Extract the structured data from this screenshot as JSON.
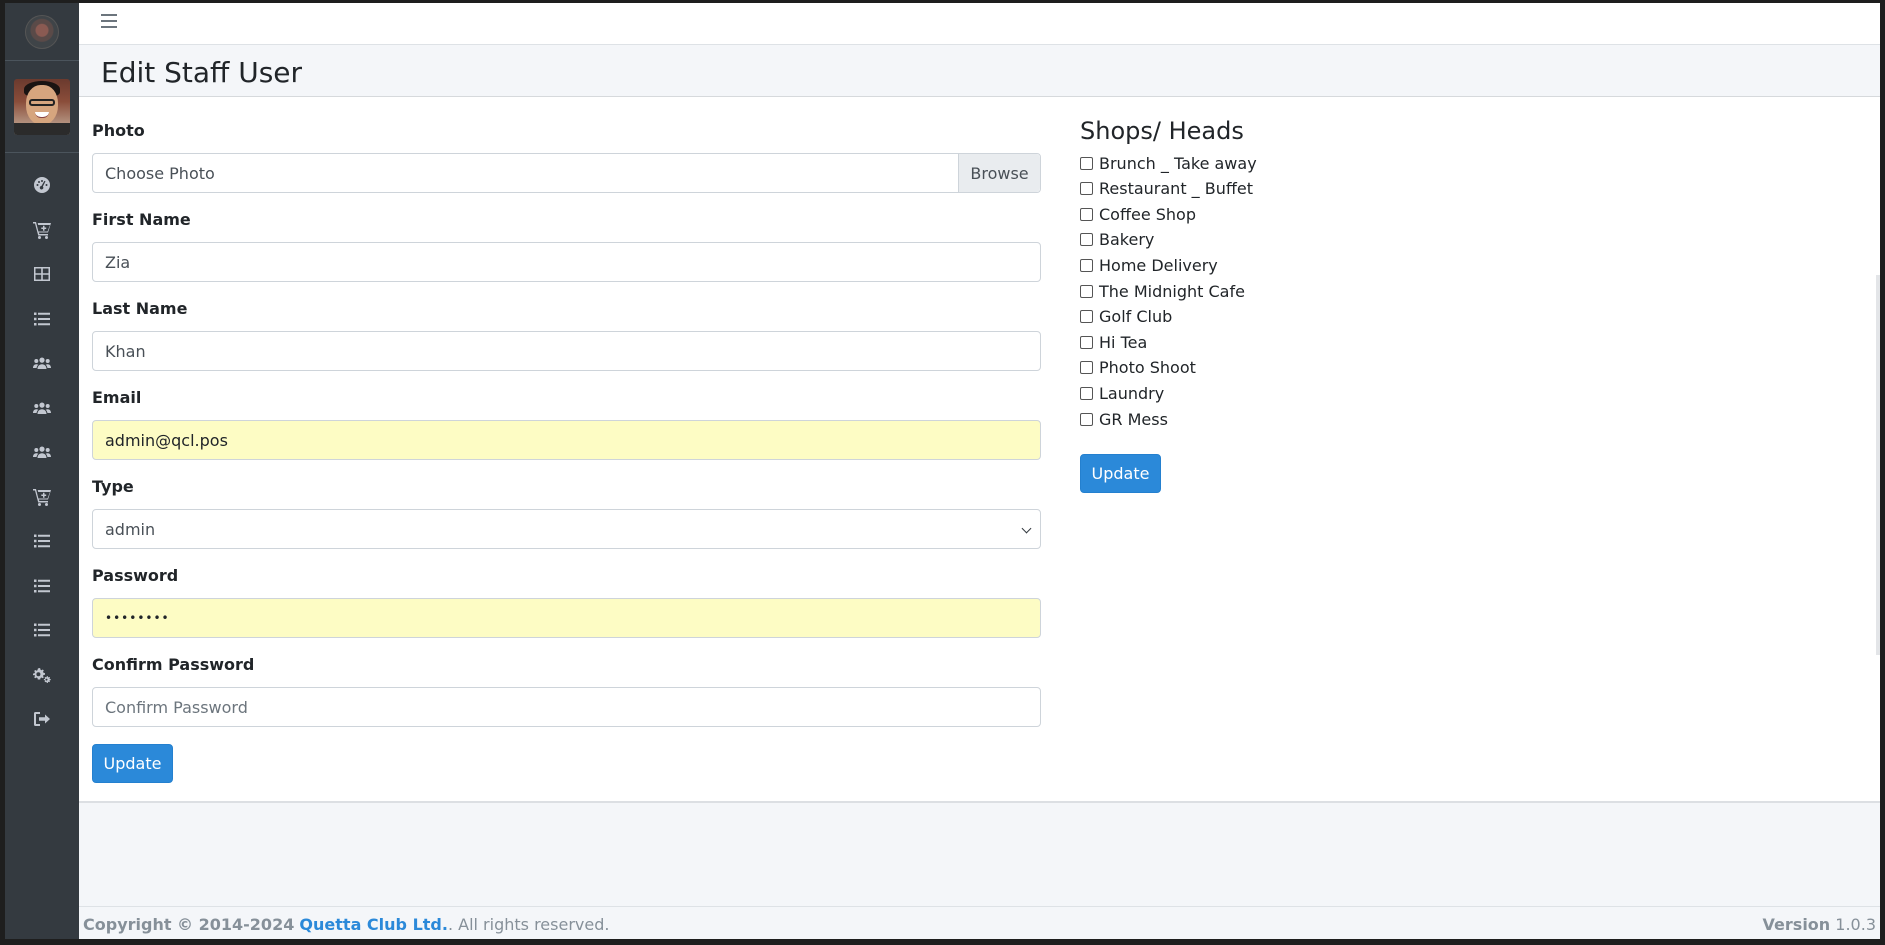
{
  "sidebar": {
    "icons": [
      "dashboard-icon",
      "cart-plus-icon",
      "table-icon",
      "list-icon",
      "users-icon",
      "users-icon",
      "users-icon",
      "cart-plus-icon",
      "list-icon",
      "list-icon",
      "list-icon",
      "cogs-icon",
      "sign-out-icon"
    ]
  },
  "header": {
    "page_title": "Edit Staff User"
  },
  "form": {
    "photo_label": "Photo",
    "photo_placeholder": "Choose Photo",
    "browse_label": "Browse",
    "first_name_label": "First Name",
    "first_name_value": "Zia",
    "last_name_label": "Last Name",
    "last_name_value": "Khan",
    "email_label": "Email",
    "email_value": "admin@qcl.pos",
    "type_label": "Type",
    "type_value": "admin",
    "password_label": "Password",
    "password_value": "••••••••",
    "confirm_password_label": "Confirm Password",
    "confirm_password_placeholder": "Confirm Password",
    "update_label": "Update"
  },
  "shops": {
    "title": "Shops/ Heads",
    "items": [
      "Brunch _ Take away",
      "Restaurant _ Buffet",
      "Coffee Shop",
      "Bakery",
      "Home Delivery",
      "The Midnight Cafe",
      "Golf Club",
      "Hi Tea",
      "Photo Shoot",
      "Laundry",
      "GR Mess"
    ],
    "update_label": "Update"
  },
  "footer": {
    "copyright_prefix": "Copyright © 2014-2024",
    "company": "Quetta Club Ltd.",
    "suffix": ". All rights reserved.",
    "version_label": "Version",
    "version_value": "1.0.3"
  },
  "colors": {
    "sidebar_bg": "#343a40",
    "primary": "#2b89d9",
    "autofill": "#fdfcc4"
  }
}
